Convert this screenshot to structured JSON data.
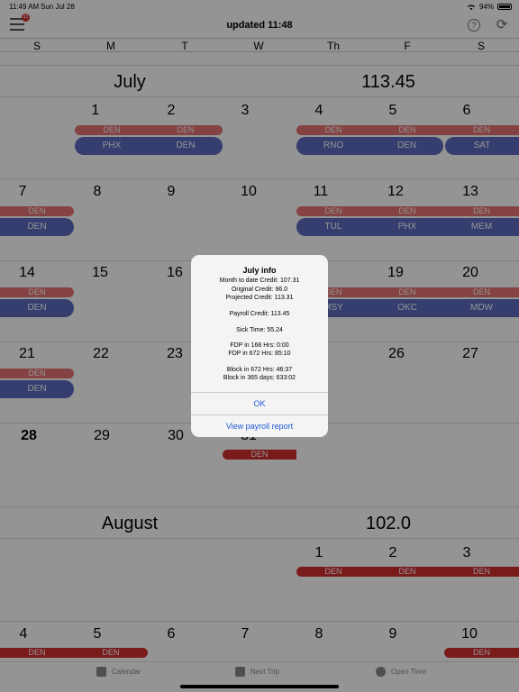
{
  "status": {
    "time": "11:49 AM",
    "date": "Sun Jul 28",
    "battery": "94%"
  },
  "toolbar": {
    "title": "updated 11:48",
    "menu_badge": "11",
    "help_label": "?",
    "refresh_label": "⟳"
  },
  "weekdays": [
    "S",
    "M",
    "T",
    "W",
    "Th",
    "F",
    "S"
  ],
  "july": {
    "name": "July",
    "credit": "113.45"
  },
  "august": {
    "name": "August",
    "credit": "102.0"
  },
  "july_days": {
    "w1": [
      "1",
      "2",
      "3",
      "4",
      "5",
      "6"
    ],
    "w2": [
      "7",
      "8",
      "9",
      "10",
      "11",
      "12",
      "13"
    ],
    "w3": [
      "14",
      "15",
      "16",
      "",
      "",
      "19",
      "20"
    ],
    "w4": [
      "21",
      "22",
      "23",
      "",
      "",
      "26",
      "27"
    ],
    "w5": [
      "28",
      "29",
      "30",
      "31"
    ]
  },
  "august_days": {
    "w1": [
      "1",
      "2",
      "3"
    ],
    "w2": [
      "4",
      "5",
      "6",
      "7",
      "8",
      "9",
      "10"
    ]
  },
  "trips": {
    "den": "DEN",
    "phx": "PHX",
    "rno": "RNO",
    "sat": "SAT",
    "tul": "TUL",
    "mem": "MEM",
    "msy": "MSY",
    "okc": "OKC",
    "mdw": "MDW"
  },
  "dialog": {
    "title": "July info",
    "lines": [
      "Month to date Credit: 107.31",
      "Original Credit: 96.0",
      "Projected Credit: 113.31",
      "Payroll Credit: 113.45",
      "Sick Time: 55.24",
      "FDP in 168 Hrs: 0:00",
      "FDP in 672 Hrs: 85:10",
      "Block in 672 Hrs: 46:37",
      "Block in 365 days: 633:02"
    ],
    "ok": "OK",
    "payroll": "View payroll report"
  },
  "tabs": {
    "calendar": "Calendar",
    "next_trip": "Next Trip",
    "open_time": "Open Time"
  }
}
